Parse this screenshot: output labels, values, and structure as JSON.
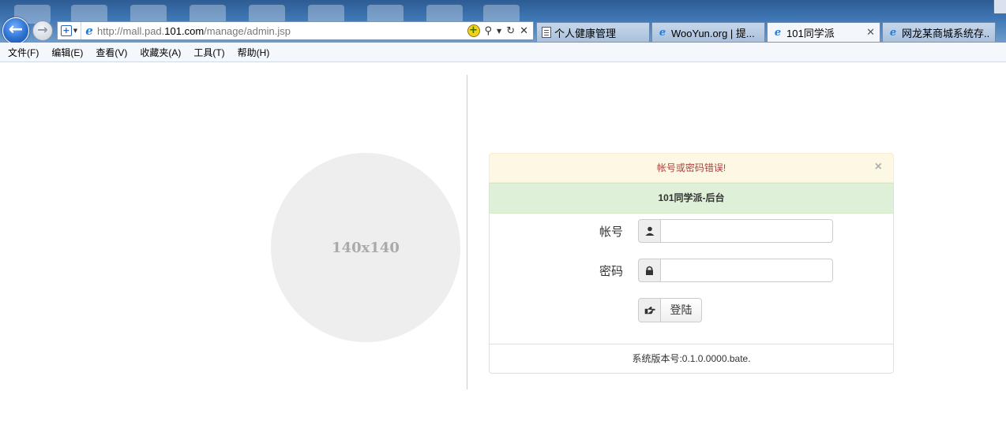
{
  "browser": {
    "url_prefix": "http://mall.pad.",
    "url_domain": "101.com",
    "url_path": "/manage/admin.jsp",
    "tabs": [
      {
        "label": "个人健康管理",
        "active": false
      },
      {
        "label": "WooYun.org | 提...",
        "active": false
      },
      {
        "label": "101同学派",
        "active": true
      },
      {
        "label": "网龙某商城系统存...",
        "active": false
      }
    ],
    "menu": [
      "文件(F)",
      "编辑(E)",
      "查看(V)",
      "收藏夹(A)",
      "工具(T)",
      "帮助(H)"
    ]
  },
  "page": {
    "placeholder_text": "140x140",
    "alert_text": "帐号或密码错误!",
    "alert_close": "×",
    "panel_title": "101同学派-后台",
    "account_label": "帐号",
    "password_label": "密码",
    "login_label": "登陆",
    "version_text": "系统版本号:0.1.0.0000.bate."
  },
  "colors": {
    "alert_bg": "#fcf8e3",
    "alert_text": "#a94442",
    "panel_heading_bg": "#dff0d8",
    "placeholder_bg": "#eeeeee"
  }
}
